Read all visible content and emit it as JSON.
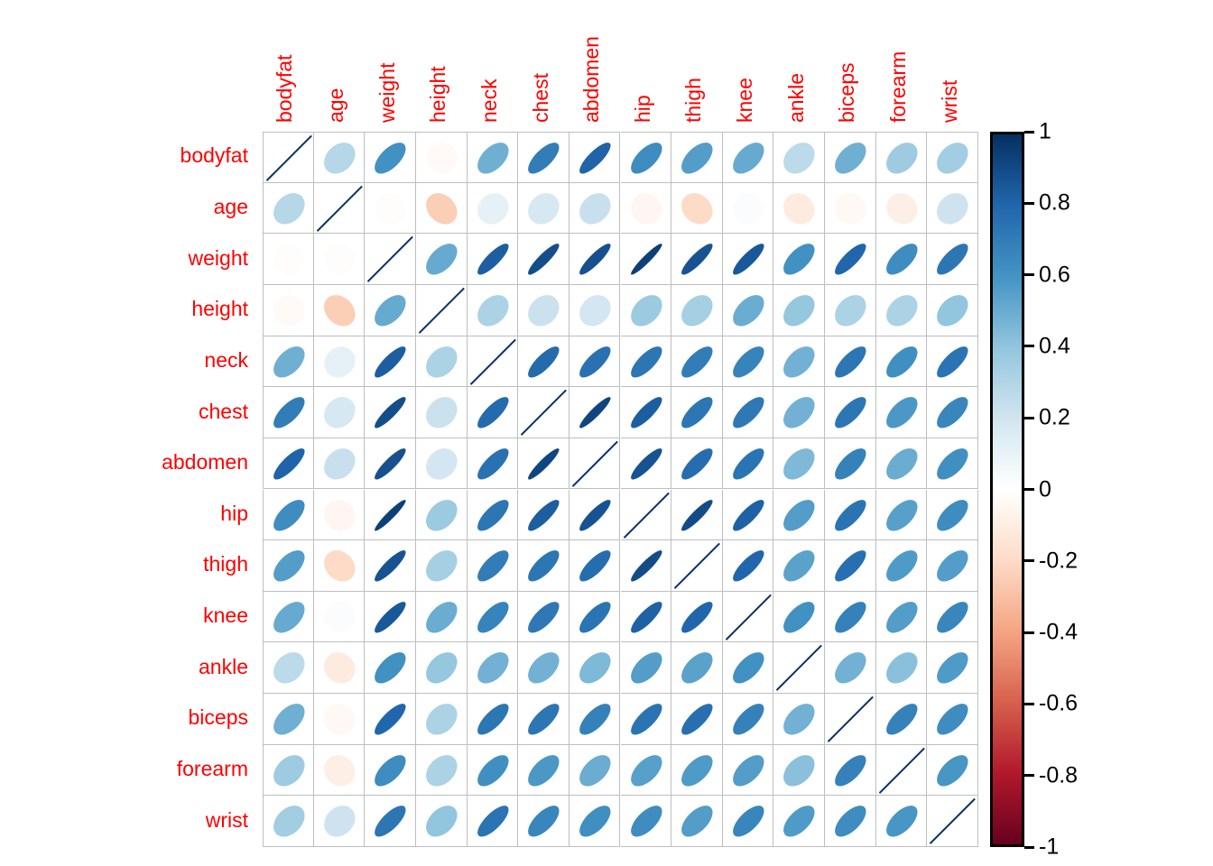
{
  "chart_data": {
    "type": "heatmap",
    "subtype": "correlation-ellipse-matrix",
    "title": "",
    "xlabel": "",
    "ylabel": "",
    "grid": true,
    "legend_position": "right",
    "colormap": {
      "name": "RdBu-reversed",
      "negative_extreme": "#67001F",
      "negative_mid": "#D6604D",
      "neutral": "#FFFFFF",
      "positive_mid": "#4393C3",
      "positive_extreme": "#053061"
    },
    "zlim": [
      -1,
      1
    ],
    "legend_ticks": [
      "1",
      "0.8",
      "0.6",
      "0.4",
      "0.2",
      "0",
      "-0.2",
      "-0.4",
      "-0.6",
      "-0.8",
      "-1"
    ],
    "legend_tick_values": [
      1,
      0.8,
      0.6,
      0.4,
      0.2,
      0,
      -0.2,
      -0.4,
      -0.6,
      -0.8,
      -1
    ],
    "categories": [
      "bodyfat",
      "age",
      "weight",
      "height",
      "neck",
      "chest",
      "abdomen",
      "hip",
      "thigh",
      "knee",
      "ankle",
      "biceps",
      "forearm",
      "wrist"
    ],
    "row_labels": [
      "bodyfat",
      "age",
      "weight",
      "height",
      "neck",
      "chest",
      "abdomen",
      "hip",
      "thigh",
      "knee",
      "ankle",
      "biceps",
      "forearm",
      "wrist"
    ],
    "col_labels": [
      "bodyfat",
      "age",
      "weight",
      "height",
      "neck",
      "chest",
      "abdomen",
      "hip",
      "thigh",
      "knee",
      "ankle",
      "biceps",
      "forearm",
      "wrist"
    ],
    "label_color": "#FF0000",
    "matrix": [
      [
        1.0,
        0.29,
        0.61,
        -0.03,
        0.49,
        0.7,
        0.81,
        0.63,
        0.56,
        0.51,
        0.27,
        0.49,
        0.36,
        0.35
      ],
      [
        0.29,
        1.0,
        -0.01,
        -0.25,
        0.11,
        0.18,
        0.23,
        -0.05,
        -0.2,
        0.02,
        -0.11,
        -0.04,
        -0.09,
        0.21
      ],
      [
        -0.01,
        -0.01,
        1.0,
        0.51,
        0.83,
        0.89,
        0.88,
        0.94,
        0.87,
        0.85,
        0.61,
        0.8,
        0.63,
        0.73
      ],
      [
        -0.03,
        -0.25,
        0.51,
        1.0,
        0.32,
        0.22,
        0.19,
        0.37,
        0.34,
        0.5,
        0.39,
        0.32,
        0.32,
        0.4
      ],
      [
        0.49,
        0.11,
        0.83,
        0.32,
        1.0,
        0.78,
        0.75,
        0.73,
        0.7,
        0.67,
        0.48,
        0.73,
        0.62,
        0.74
      ],
      [
        0.7,
        0.18,
        0.89,
        0.22,
        0.78,
        1.0,
        0.92,
        0.83,
        0.73,
        0.72,
        0.48,
        0.73,
        0.58,
        0.66
      ],
      [
        0.81,
        0.23,
        0.88,
        0.19,
        0.75,
        0.92,
        1.0,
        0.87,
        0.77,
        0.74,
        0.45,
        0.68,
        0.5,
        0.62
      ],
      [
        0.63,
        -0.05,
        0.94,
        0.37,
        0.73,
        0.83,
        0.87,
        1.0,
        0.9,
        0.82,
        0.56,
        0.74,
        0.55,
        0.63
      ],
      [
        0.56,
        -0.2,
        0.87,
        0.34,
        0.7,
        0.73,
        0.77,
        0.9,
        1.0,
        0.8,
        0.54,
        0.76,
        0.57,
        0.56
      ],
      [
        0.51,
        0.02,
        0.85,
        0.5,
        0.67,
        0.72,
        0.74,
        0.82,
        0.8,
        1.0,
        0.61,
        0.68,
        0.56,
        0.66
      ],
      [
        0.27,
        -0.11,
        0.61,
        0.39,
        0.48,
        0.48,
        0.45,
        0.56,
        0.54,
        0.61,
        1.0,
        0.48,
        0.42,
        0.57
      ],
      [
        0.49,
        -0.04,
        0.8,
        0.32,
        0.73,
        0.73,
        0.68,
        0.74,
        0.76,
        0.68,
        0.48,
        1.0,
        0.68,
        0.63
      ],
      [
        0.36,
        -0.09,
        0.63,
        0.32,
        0.62,
        0.58,
        0.5,
        0.55,
        0.57,
        0.56,
        0.42,
        0.68,
        1.0,
        0.59
      ],
      [
        0.35,
        0.21,
        0.73,
        0.4,
        0.74,
        0.66,
        0.62,
        0.63,
        0.56,
        0.66,
        0.57,
        0.63,
        0.59,
        1.0
      ]
    ]
  }
}
